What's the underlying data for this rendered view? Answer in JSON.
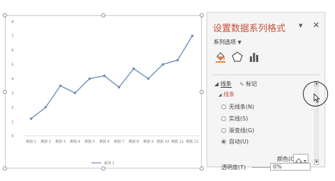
{
  "pane": {
    "title": "设置数据系列格式",
    "dropdown_icon": "chevron-down-icon",
    "close_icon": "close-icon",
    "series_options_label": "系列选项",
    "icons": [
      "fill-line-icon",
      "effects-pentagon-icon",
      "series-options-bars-icon"
    ],
    "tabs": {
      "line": "线条",
      "marker": "标记"
    },
    "section": "线条",
    "line_options": [
      {
        "label": "无线条(N)",
        "selected": false
      },
      {
        "label": "实线(S)",
        "selected": false
      },
      {
        "label": "渐变线(G)",
        "selected": false
      },
      {
        "label": "自动(U)",
        "selected": true
      }
    ],
    "color_label": "颜色(C)",
    "transparency_label": "透明度(T)",
    "transparency_value": "0%",
    "accent_color": "#c5513b"
  },
  "chart_data": {
    "type": "line",
    "categories": [
      "类别 1",
      "类别 2",
      "类别 3",
      "类别 4",
      "类别 5",
      "类别 6",
      "类别 7",
      "类别 8",
      "类别 9",
      "类别 10",
      "类别 11",
      "类别 12"
    ],
    "series": [
      {
        "name": "系列 1",
        "values": [
          1.2,
          2.0,
          3.5,
          3.0,
          4.0,
          4.2,
          3.4,
          4.7,
          4.0,
          5.0,
          5.3,
          7.0
        ],
        "color": "#6f8fb9"
      }
    ],
    "ylim": [
      0,
      8
    ],
    "yticks": [
      "0",
      "1",
      "2",
      "3",
      "4",
      "5",
      "6",
      "7",
      "8"
    ],
    "legend": "bottom",
    "grid": false
  }
}
